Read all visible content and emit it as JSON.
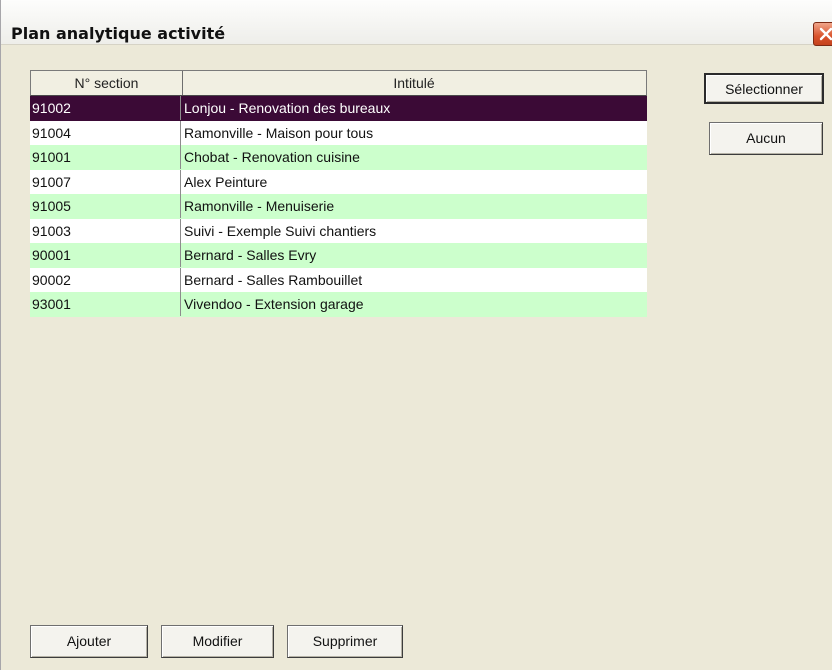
{
  "window": {
    "title": "Plan analytique activité",
    "close_icon": "close-icon",
    "close_color": "#d9532c"
  },
  "table": {
    "columns": [
      "N° section",
      "Intitulé"
    ],
    "rows": [
      {
        "section": "91002",
        "label": "Lonjou - Renovation des bureaux",
        "selected": true
      },
      {
        "section": "91004",
        "label": "Ramonville - Maison pour tous"
      },
      {
        "section": "91001",
        "label": "Chobat - Renovation cuisine"
      },
      {
        "section": "91007",
        "label": "Alex Peinture"
      },
      {
        "section": "91005",
        "label": "Ramonville - Menuiserie"
      },
      {
        "section": "91003",
        "label": "Suivi - Exemple Suivi chantiers"
      },
      {
        "section": "90001",
        "label": "Bernard - Salles Evry"
      },
      {
        "section": "90002",
        "label": "Bernard - Salles Rambouillet"
      },
      {
        "section": "93001",
        "label": "Vivendoo - Extension garage"
      }
    ],
    "colors": {
      "selected_bg": "#3b0a36",
      "alt_row_bg": "#ccffcc",
      "plain_row_bg": "#ffffff"
    }
  },
  "buttons": {
    "select": "Sélectionner",
    "none": "Aucun",
    "add": "Ajouter",
    "modify": "Modifier",
    "delete": "Supprimer"
  }
}
